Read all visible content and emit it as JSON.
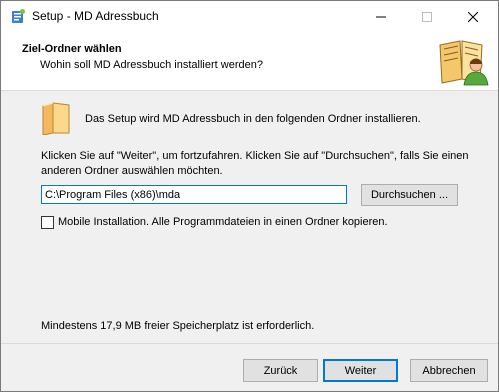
{
  "window": {
    "title": "Setup - MD Adressbuch"
  },
  "header": {
    "title": "Ziel-Ordner wählen",
    "subtitle": "Wohin soll MD Adressbuch installiert werden?"
  },
  "content": {
    "intro": "Das Setup wird MD Adressbuch in den folgenden Ordner installieren.",
    "instruction": "Klicken Sie auf \"Weiter\", um fortzufahren. Klicken Sie auf \"Durchsuchen\", falls Sie einen anderen Ordner auswählen möchten.",
    "path_value": "C:\\Program Files (x86)\\mda",
    "browse_label": "Durchsuchen ...",
    "mobile_label": "Mobile Installation. Alle Programmdateien in einen Ordner kopieren.",
    "mobile_checked": false,
    "space_text": "Mindestens 17,9 MB freier Speicherplatz ist erforderlich."
  },
  "footer": {
    "back_label": "Zurück",
    "next_label": "Weiter",
    "cancel_label": "Abbrechen"
  },
  "colors": {
    "accent": "#0078d7",
    "button_face": "#e1e1e1",
    "dialog_bg": "#f0f0f0"
  },
  "icons": [
    "setup-app-icon",
    "minimize-icon",
    "maximize-icon",
    "close-icon",
    "addressbook-wizard-icon",
    "folder-icon"
  ]
}
